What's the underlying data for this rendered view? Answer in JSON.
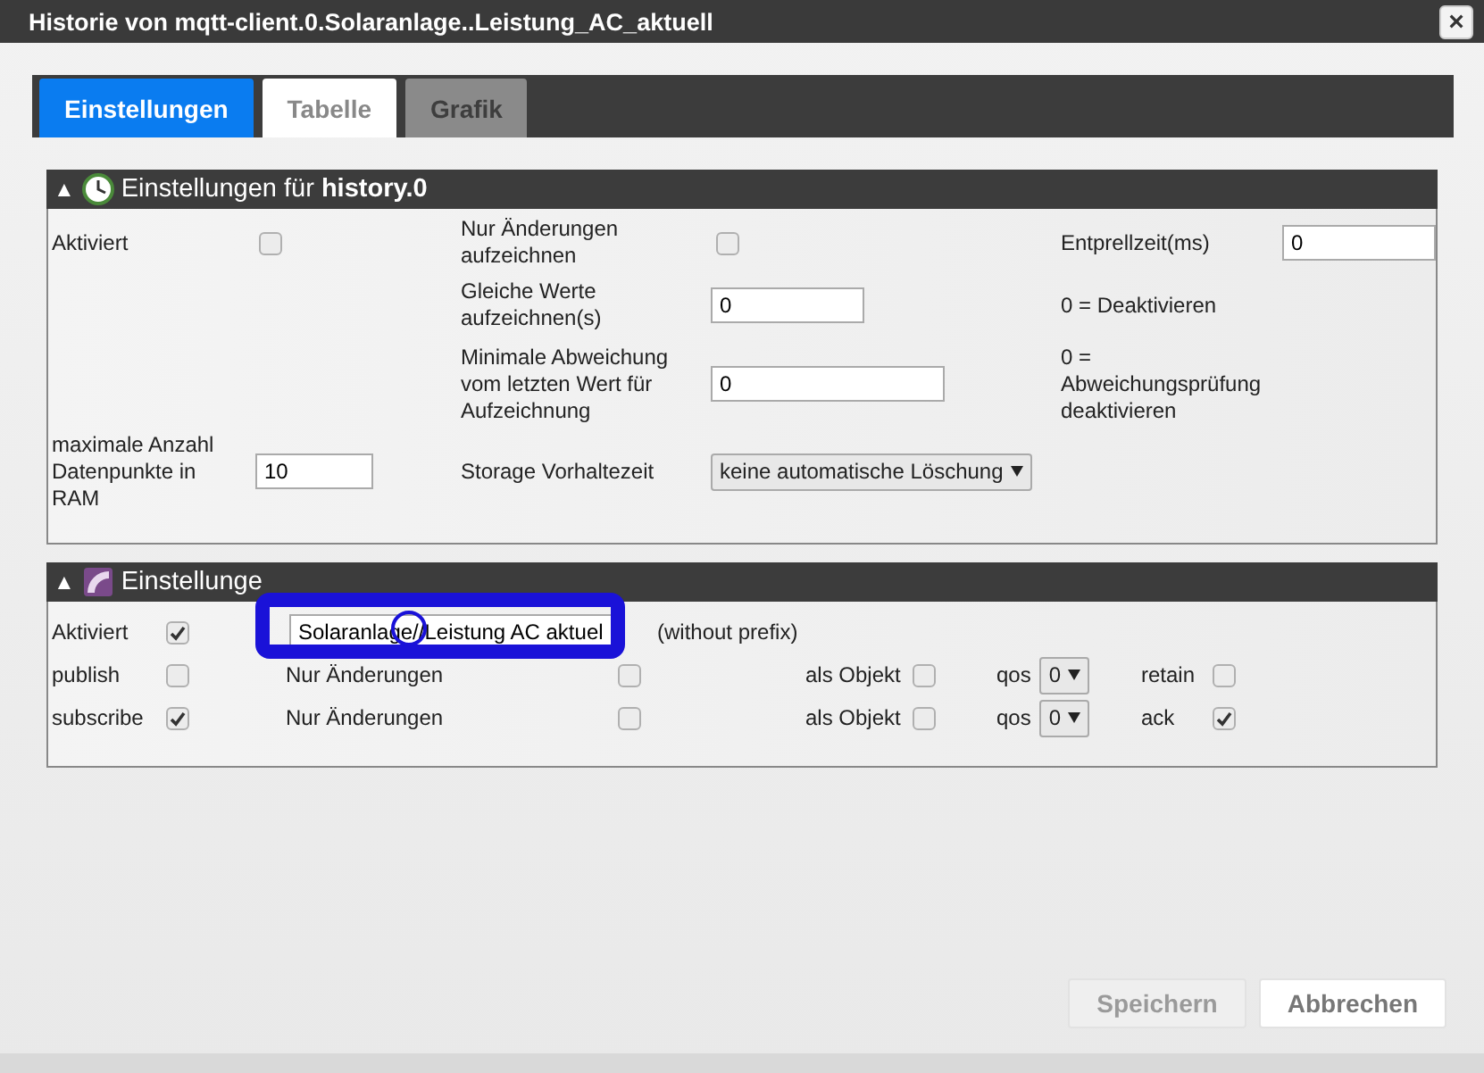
{
  "window": {
    "title": "Historie von mqtt-client.0.Solaranlage..Leistung_AC_aktuell",
    "close": "×"
  },
  "tabs": [
    {
      "label": "Einstellungen",
      "selected": true,
      "disabled": false
    },
    {
      "label": "Tabelle",
      "selected": false,
      "disabled": false
    },
    {
      "label": "Grafik",
      "selected": false,
      "disabled": true
    }
  ],
  "history_panel": {
    "toggle": "▲",
    "title": "Einstellungen für **history.0**",
    "enabled": {
      "label": "Aktiviert",
      "checked": false
    },
    "changes_only": {
      "label": "Nur Änderungen aufzeichnen",
      "checked": false
    },
    "debounce": {
      "label": "Entprellzeit(ms)",
      "value": "0"
    },
    "same_values": {
      "label": "Gleiche Werte aufzeichnen(s)",
      "value": "0",
      "hint": "0 = Deaktivieren"
    },
    "min_delta": {
      "label": "Minimale Abweichung vom letzten Wert für Aufzeichnung",
      "value": "0",
      "hint": "0 = Abweichungsprüfung deaktivieren"
    },
    "max_points": {
      "label": "maximale Anzahl Datenpunkte in RAM",
      "value": "10"
    },
    "retention": {
      "label": "Storage Vorhaltezeit",
      "value": "keine automatische Löschung"
    }
  },
  "mqtt_panel": {
    "toggle": "▲",
    "title": "Einstellunge",
    "enabled": {
      "label": "Aktiviert",
      "checked": true
    },
    "topic": {
      "value": "Solaranlage//Leistung AC aktuel",
      "note": "(without prefix)"
    },
    "rows": [
      {
        "label": "publish",
        "checked": false,
        "changes_label": "Nur Änderungen",
        "changes_checked": false,
        "object_label": "als Objekt",
        "object_checked": false,
        "qos_label": "qos",
        "qos": "0",
        "extra_label": "retain",
        "extra_checked": false
      },
      {
        "label": "subscribe",
        "checked": true,
        "changes_label": "Nur Änderungen",
        "changes_checked": false,
        "object_label": "als Objekt",
        "object_checked": false,
        "qos_label": "qos",
        "qos": "0",
        "extra_label": "ack",
        "extra_checked": true
      }
    ]
  },
  "buttons": [
    {
      "label": "Speichern",
      "disabled": true
    },
    {
      "label": "Abbrechen",
      "disabled": false
    }
  ]
}
